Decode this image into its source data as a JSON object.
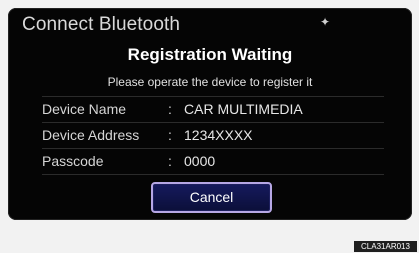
{
  "screen": {
    "title": "Connect Bluetooth",
    "heading": "Registration Waiting",
    "instruction": "Please operate the device to register it",
    "bluetooth_icon": "bluetooth-icon"
  },
  "details": {
    "rows": [
      {
        "label": "Device Name",
        "value": "CAR MULTIMEDIA"
      },
      {
        "label": "Device Address",
        "value": "1234XXXX"
      },
      {
        "label": "Passcode",
        "value": "0000"
      }
    ]
  },
  "actions": {
    "cancel_label": "Cancel"
  },
  "footer": {
    "image_code": "CLA31AR013"
  },
  "colors": {
    "screen_background": "#050505",
    "button_border": "#b6a7e5",
    "button_fill": "#111548"
  }
}
